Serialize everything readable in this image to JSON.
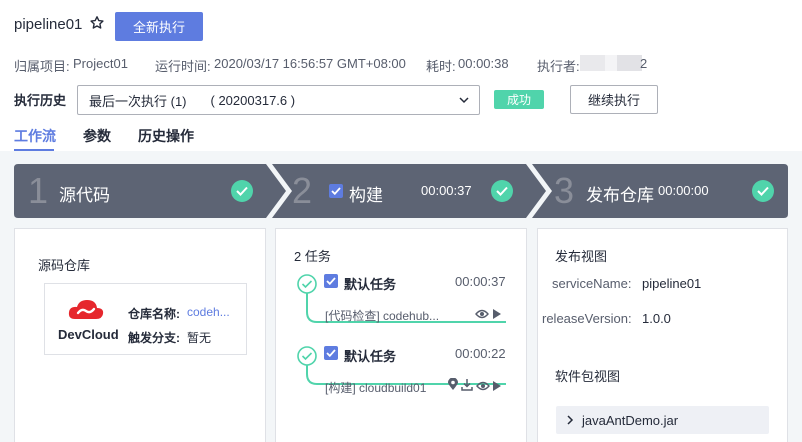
{
  "header": {
    "title": "pipeline01",
    "run_all_label": "全新执行"
  },
  "meta": {
    "project_label": "归属项目:",
    "project_value": "Project01",
    "run_time_label": "运行时间:",
    "run_time_value": "2020/03/17 16:56:57 GMT+08:00",
    "duration_label": "耗时:",
    "duration_value": "00:00:38",
    "executor_label": "执行者:",
    "executor_value_tail": "2"
  },
  "history": {
    "label": "执行历史",
    "selected": "最后一次执行 (1)",
    "selected_build": "( 20200317.6 )",
    "status": "成功",
    "continue_label": "继续执行"
  },
  "tabs": [
    {
      "label": "工作流",
      "active": true
    },
    {
      "label": "参数",
      "active": false
    },
    {
      "label": "历史操作",
      "active": false
    }
  ],
  "stages": [
    {
      "num": "1",
      "name": "源代码",
      "time": ""
    },
    {
      "num": "2",
      "name": "构建",
      "time": "00:00:37"
    },
    {
      "num": "3",
      "name": "发布仓库",
      "time": "00:00:00"
    }
  ],
  "source_panel": {
    "title": "源码仓库",
    "brand": "DevCloud",
    "repo_name_label": "仓库名称:",
    "repo_name_value": "codeh...",
    "branch_label": "触发分支:",
    "branch_value": "暂无"
  },
  "tasks_panel": {
    "title": "2 任务",
    "jobs": [
      {
        "title": "默认任务",
        "time": "00:00:37",
        "sub": "[代码检查] codehub..."
      },
      {
        "title": "默认任务",
        "time": "00:00:22",
        "sub": "[构建] cloudbuild01"
      }
    ]
  },
  "release_panel": {
    "title": "发布视图",
    "service_label": "serviceName:",
    "service_value": "pipeline01",
    "version_label": "releaseVersion:",
    "version_value": "1.0.0",
    "package_title": "软件包视图",
    "package_item": "javaAntDemo.jar"
  },
  "colors": {
    "primary": "#5e7ce0",
    "success": "#50d4ab",
    "stage_bg": "#5d6474"
  }
}
